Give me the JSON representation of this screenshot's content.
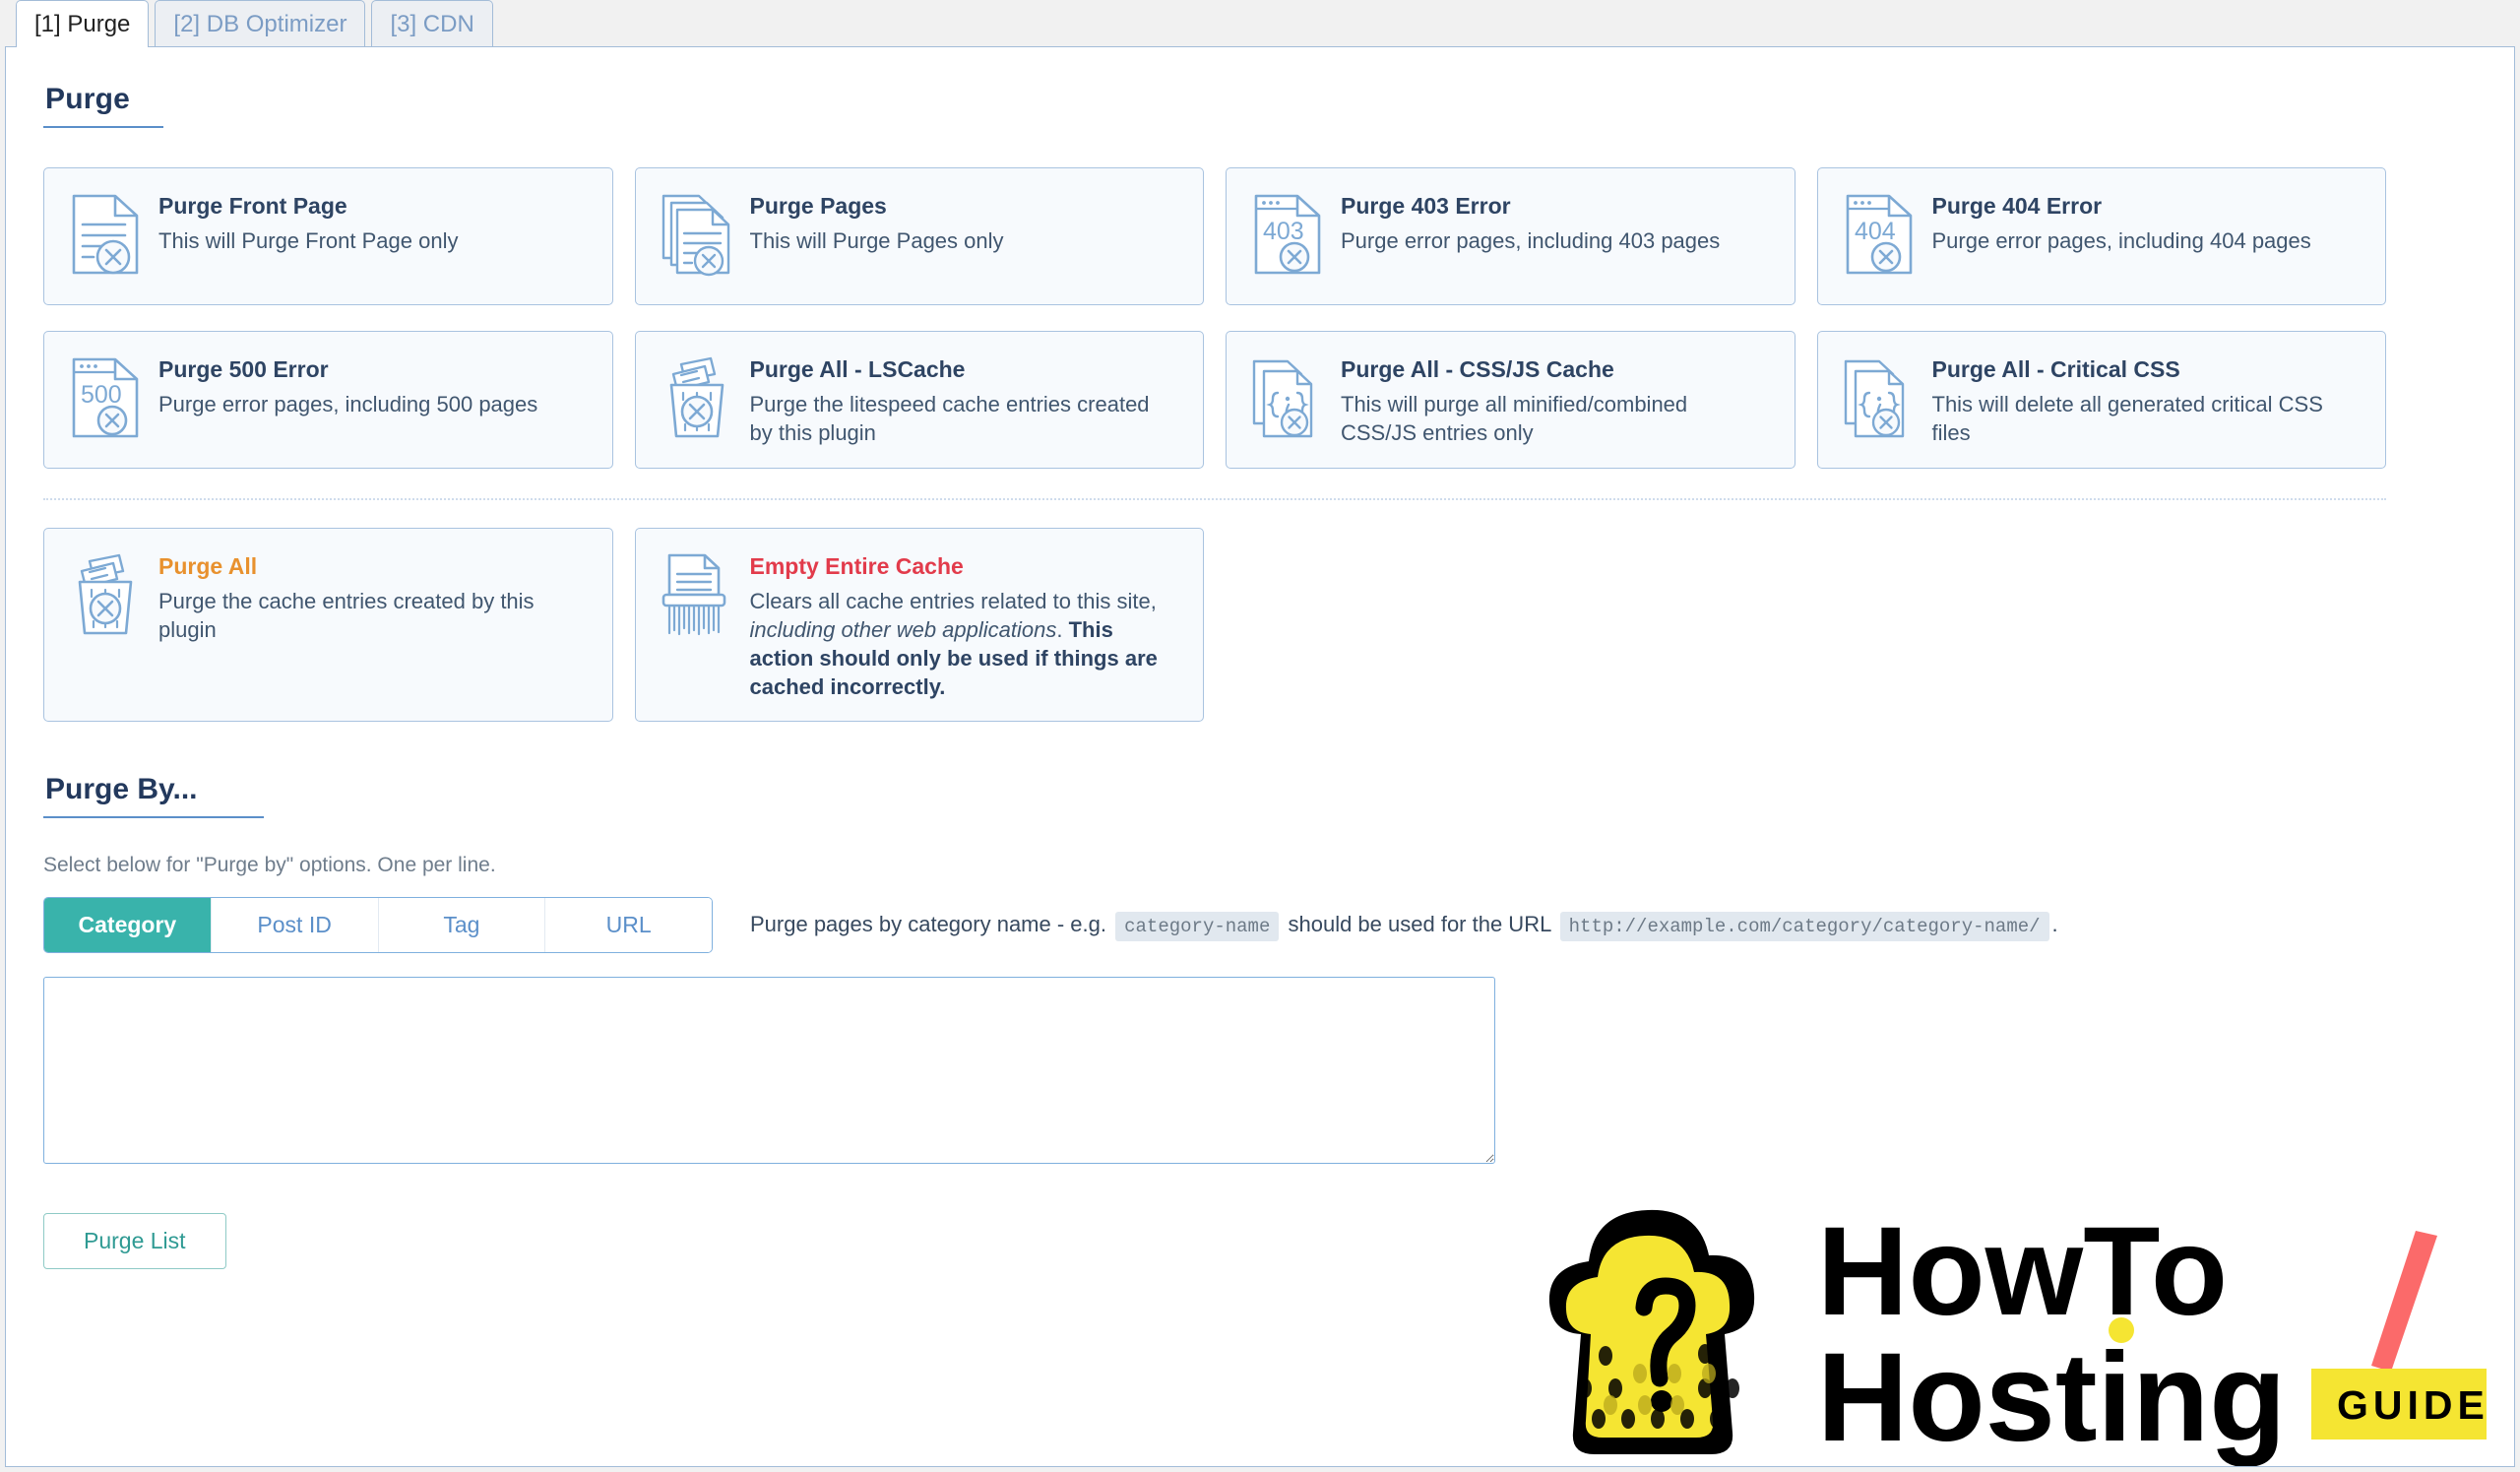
{
  "tabs": [
    {
      "label": "[1] Purge",
      "active": true
    },
    {
      "label": "[2] DB Optimizer",
      "active": false
    },
    {
      "label": "[3] CDN",
      "active": false
    }
  ],
  "sections": {
    "purge_title": "Purge",
    "purge_by_title": "Purge By...",
    "purge_by_hint": "Select below for \"Purge by\" options. One per line."
  },
  "cards_row1": [
    {
      "icon": "document-x-icon",
      "title": "Purge Front Page",
      "desc": "This will Purge Front Page only"
    },
    {
      "icon": "documents-stack-x-icon",
      "title": "Purge Pages",
      "desc": "This will Purge Pages only"
    },
    {
      "icon": "document-403-x-icon",
      "code": "403",
      "title": "Purge 403 Error",
      "desc": "Purge error pages, including 403 pages"
    },
    {
      "icon": "document-404-x-icon",
      "code": "404",
      "title": "Purge 404 Error",
      "desc": "Purge error pages, including 404 pages"
    }
  ],
  "cards_row2": [
    {
      "icon": "document-500-x-icon",
      "code": "500",
      "title": "Purge 500 Error",
      "desc": "Purge error pages, including 500 pages"
    },
    {
      "icon": "trash-bin-x-icon",
      "title": "Purge All - LSCache",
      "desc": "Purge the litespeed cache entries created by this plugin"
    },
    {
      "icon": "code-documents-x-icon",
      "title": "Purge All - CSS/JS Cache",
      "desc": "This will purge all minified/combined CSS/JS entries only"
    },
    {
      "icon": "code-documents-x-icon",
      "title": "Purge All - Critical CSS",
      "desc": "This will delete all generated critical CSS files"
    }
  ],
  "cards_row3": [
    {
      "icon": "trash-bin-x-icon",
      "title": "Purge All",
      "title_color": "#e8912e",
      "desc": "Purge the cache entries created by this plugin"
    },
    {
      "icon": "shredder-icon",
      "title": "Empty Entire Cache",
      "title_color": "#e23b4b",
      "desc_part1": "Clears all cache entries related to this site, ",
      "desc_italic": "including other web applications",
      "desc_part2": ". ",
      "desc_bold": "This action should only be used if things are cached incorrectly."
    }
  ],
  "purge_by": {
    "segments": [
      {
        "label": "Category",
        "active": true
      },
      {
        "label": "Post ID",
        "active": false
      },
      {
        "label": "Tag",
        "active": false
      },
      {
        "label": "URL",
        "active": false
      }
    ],
    "explain_pre": "Purge pages by category name - e.g.",
    "explain_code1": "category-name",
    "explain_mid": "should be used for the URL",
    "explain_code2": "http://example.com/category/category-name/",
    "explain_post": ".",
    "textarea_value": "",
    "textarea_placeholder": "",
    "submit_label": "Purge List"
  },
  "logo": {
    "line1": "HowTo",
    "line2": "Hosting",
    "badge": "GUIDE"
  },
  "colors": {
    "accent_teal": "#39b3ab",
    "accent_blue": "#5b8fc9",
    "warn_orange": "#e8912e",
    "danger_red": "#e23b4b",
    "card_bg": "#f7fafd",
    "card_border": "#a9c3e0"
  }
}
